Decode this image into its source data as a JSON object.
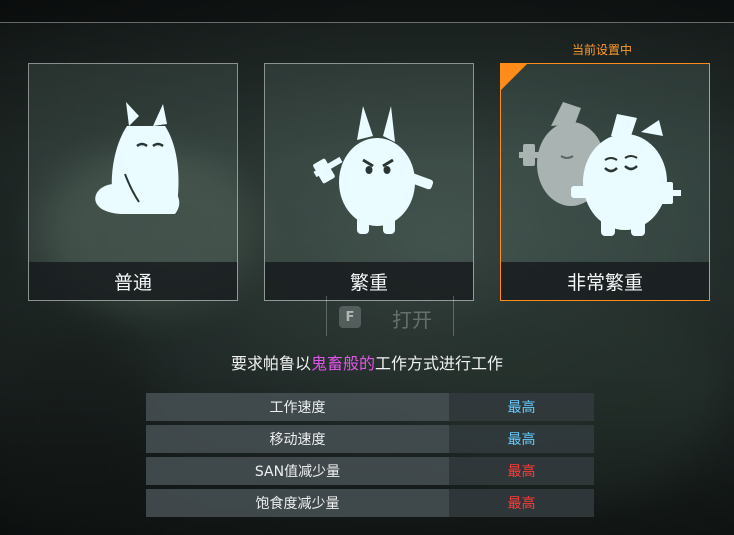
{
  "status": {
    "current_label": "当前设置中"
  },
  "cards": [
    {
      "label": "普通",
      "icon": "normal-pal-icon",
      "selected": false
    },
    {
      "label": "繁重",
      "icon": "heavy-pal-icon",
      "selected": false
    },
    {
      "label": "非常繁重",
      "icon": "very-heavy-pal-icon",
      "selected": true
    }
  ],
  "hint": {
    "key": "F",
    "action": "打开"
  },
  "description": {
    "prefix": "要求帕鲁以",
    "highlight": "鬼畜般的",
    "suffix": "工作方式进行工作"
  },
  "stats": [
    {
      "name": "工作速度",
      "value": "最高",
      "color": "#66ccff"
    },
    {
      "name": "移动速度",
      "value": "最高",
      "color": "#66ccff"
    },
    {
      "name": "SAN值减少量",
      "value": "最高",
      "color": "#ff3b3b"
    },
    {
      "name": "饱食度减少量",
      "value": "最高",
      "color": "#ff3b3b"
    }
  ],
  "colors": {
    "accent": "#ff8c1a",
    "highlight": "#e055e8",
    "icon_fill": "#eafcff"
  }
}
